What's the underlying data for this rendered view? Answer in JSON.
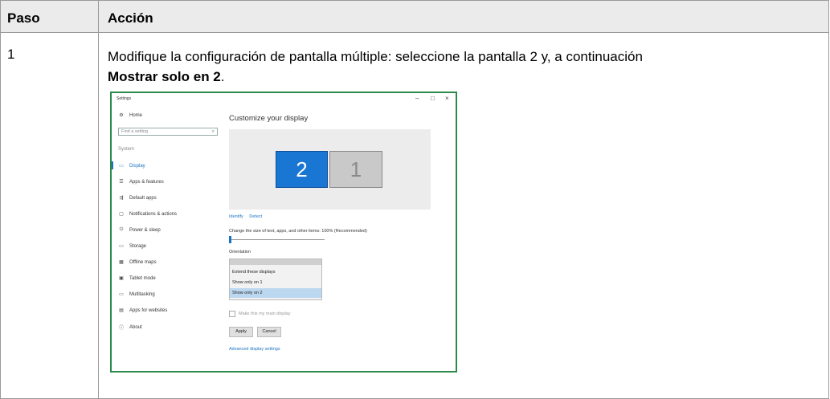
{
  "table": {
    "header_paso": "Paso",
    "header_accion": "Acción",
    "step_number": "1",
    "instruction_text": "Modifique la configuración de pantalla múltiple: seleccione la pantalla 2 y, a continuación",
    "instruction_bold": "Mostrar solo en 2",
    "instruction_end": "."
  },
  "settings": {
    "window_title": "Settings",
    "controls": {
      "minimize": "–",
      "maximize": "□",
      "close": "×"
    },
    "sidebar": {
      "home": "Home",
      "search_placeholder": "Find a setting",
      "section": "System",
      "items": [
        {
          "label": "Display",
          "icon": "monitor-icon",
          "glyph": "▭"
        },
        {
          "label": "Apps & features",
          "icon": "list-icon",
          "glyph": "☰"
        },
        {
          "label": "Default apps",
          "icon": "default-apps-icon",
          "glyph": "⇶"
        },
        {
          "label": "Notifications & actions",
          "icon": "notification-icon",
          "glyph": "▢"
        },
        {
          "label": "Power & sleep",
          "icon": "power-icon",
          "glyph": "⏻"
        },
        {
          "label": "Storage",
          "icon": "storage-icon",
          "glyph": "▭"
        },
        {
          "label": "Offline maps",
          "icon": "map-icon",
          "glyph": "▦"
        },
        {
          "label": "Tablet mode",
          "icon": "tablet-icon",
          "glyph": "▣"
        },
        {
          "label": "Multitasking",
          "icon": "multitasking-icon",
          "glyph": "▭"
        },
        {
          "label": "Apps for websites",
          "icon": "web-apps-icon",
          "glyph": "▤"
        },
        {
          "label": "About",
          "icon": "info-icon",
          "glyph": "ⓘ"
        }
      ]
    },
    "main": {
      "title": "Customize your display",
      "monitor_2": "2",
      "monitor_1": "1",
      "identify": "Identify",
      "detect": "Detect",
      "size_label": "Change the size of text, apps, and other items: 100% (Recommended)",
      "orientation_label": "Orientation",
      "dropdown_options": [
        "Extend these displays",
        "Show only on 1",
        "Show only on 2"
      ],
      "main_display_checkbox": "Make this my main display",
      "apply": "Apply",
      "cancel": "Cancel",
      "advanced_link": "Advanced display settings"
    }
  }
}
